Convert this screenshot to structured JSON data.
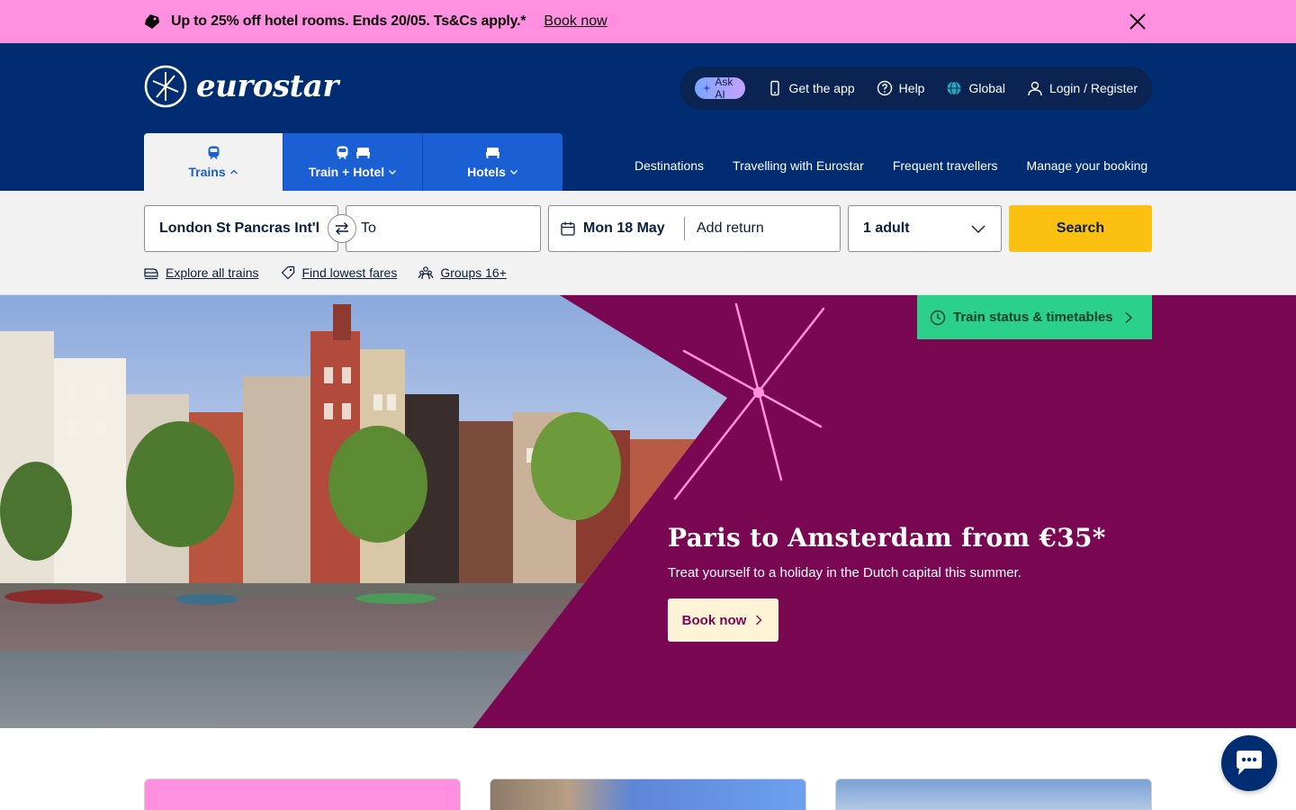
{
  "promo": {
    "text": "Up to 25% off hotel rooms. Ends 20/05. Ts&Cs apply.*",
    "link": "Book now"
  },
  "header": {
    "logo_text": "eurostar",
    "util": {
      "ask_ai": "Ask AI",
      "get_app": "Get the app",
      "help": "Help",
      "global": "Global",
      "login": "Login / Register"
    },
    "tabs": [
      {
        "label": "Trains",
        "active": true
      },
      {
        "label": "Train + Hotel",
        "active": false
      },
      {
        "label": "Hotels",
        "active": false
      }
    ],
    "nav": [
      "Destinations",
      "Travelling with Eurostar",
      "Frequent travellers",
      "Manage your booking"
    ]
  },
  "search": {
    "from": "London St Pancras Int'l",
    "to_placeholder": "To",
    "date_out": "Mon 18 May",
    "date_return": "Add return",
    "passengers": "1 adult",
    "button": "Search",
    "quick_links": [
      "Explore all trains",
      "Find lowest fares",
      "Groups 16+"
    ]
  },
  "hero": {
    "status_button": "Train status & timetables",
    "title": "Paris to Amsterdam from €35*",
    "subtitle": "Treat yourself to a holiday in the Dutch capital this summer.",
    "cta": "Book now"
  },
  "colors": {
    "navy": "#002d72",
    "promo_pink": "#ff8fdf",
    "search_yellow": "#fcc010",
    "hero_plum": "#7a0751",
    "status_green": "#2bd08a",
    "tab_blue": "#1a5fd4"
  }
}
